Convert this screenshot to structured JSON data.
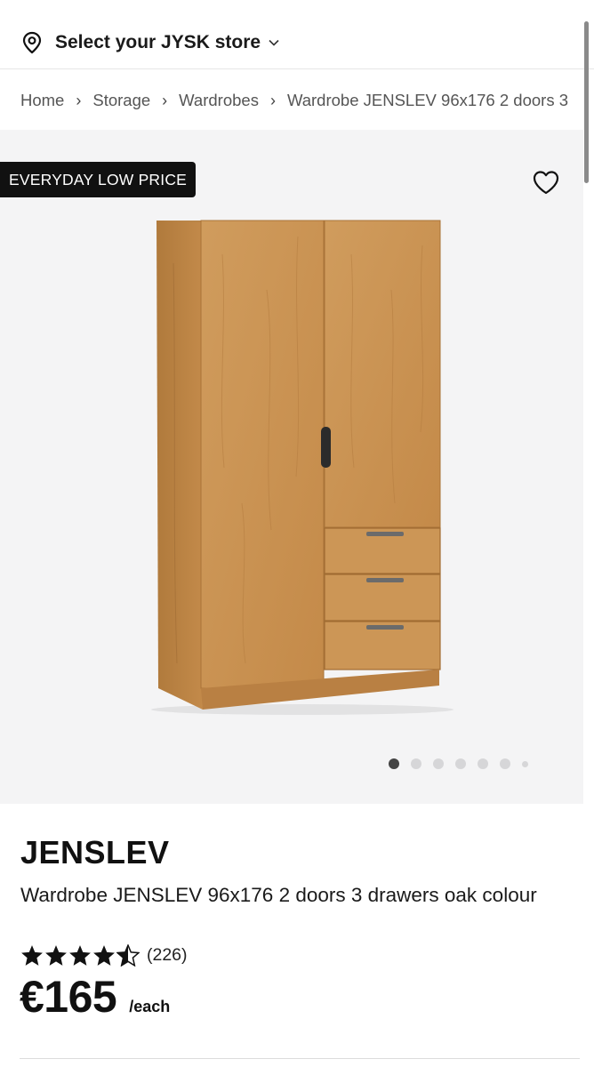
{
  "header": {
    "store_selector_label": "Select your JYSK store"
  },
  "breadcrumb": [
    {
      "label": "Home"
    },
    {
      "label": "Storage"
    },
    {
      "label": "Wardrobes"
    },
    {
      "label": "Wardrobe JENSLEV 96x176 2 doors 3"
    }
  ],
  "gallery": {
    "badge": "EVERYDAY LOW PRICE",
    "image_subject": "oak colour wardrobe with 2 doors and 3 drawers",
    "total_images": 7,
    "current_image": 1
  },
  "product": {
    "brand": "JENSLEV",
    "description": "Wardrobe JENSLEV 96x176 2 doors 3 drawers oak colour",
    "rating_stars": 4.5,
    "rating_count": "(226)",
    "price": "€165",
    "unit": "/each"
  },
  "colors": {
    "text": "#1a1a1a",
    "badge_bg": "#111111",
    "gallery_bg": "#f4f4f5",
    "oak": "#c8924f"
  }
}
